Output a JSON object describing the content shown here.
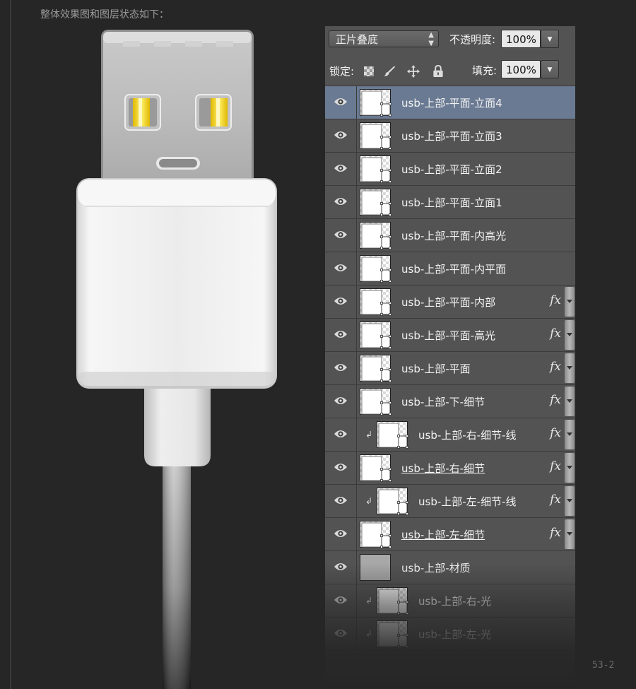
{
  "caption": "整体效果图和图层状态如下：",
  "page_number": "53-2",
  "panel": {
    "blend_mode": "正片叠底",
    "opacity_label": "不透明度:",
    "opacity_value": "100%",
    "lock_label": "锁定:",
    "fill_label": "填充:",
    "fill_value": "100%"
  },
  "layers": [
    {
      "name": "usb-上部-平面-立面4",
      "selected": true,
      "fx": false,
      "clipped": false,
      "linked": false
    },
    {
      "name": "usb-上部-平面-立面3",
      "selected": false,
      "fx": false,
      "clipped": false,
      "linked": false
    },
    {
      "name": "usb-上部-平面-立面2",
      "selected": false,
      "fx": false,
      "clipped": false,
      "linked": false
    },
    {
      "name": "usb-上部-平面-立面1",
      "selected": false,
      "fx": false,
      "clipped": false,
      "linked": false
    },
    {
      "name": "usb-上部-平面-内高光",
      "selected": false,
      "fx": false,
      "clipped": false,
      "linked": false
    },
    {
      "name": "usb-上部-平面-内平面",
      "selected": false,
      "fx": false,
      "clipped": false,
      "linked": false
    },
    {
      "name": "usb-上部-平面-内部",
      "selected": false,
      "fx": true,
      "clipped": false,
      "linked": false
    },
    {
      "name": "usb-上部-平面-高光",
      "selected": false,
      "fx": true,
      "clipped": false,
      "linked": false
    },
    {
      "name": "usb-上部-平面",
      "selected": false,
      "fx": true,
      "clipped": false,
      "linked": false
    },
    {
      "name": "usb-上部-下-细节",
      "selected": false,
      "fx": true,
      "clipped": false,
      "linked": false
    },
    {
      "name": "usb-上部-右-细节-线",
      "selected": false,
      "fx": true,
      "clipped": true,
      "linked": false
    },
    {
      "name": "usb-上部-右-细节",
      "selected": false,
      "fx": true,
      "clipped": false,
      "linked": true
    },
    {
      "name": "usb-上部-左-细节-线",
      "selected": false,
      "fx": true,
      "clipped": true,
      "linked": false
    },
    {
      "name": "usb-上部-左-细节",
      "selected": false,
      "fx": true,
      "clipped": false,
      "linked": true
    },
    {
      "name": "usb-上部-材质",
      "selected": false,
      "fx": false,
      "clipped": false,
      "linked": false,
      "texture": true
    },
    {
      "name": "usb-上部-右-光",
      "selected": false,
      "fx": false,
      "clipped": true,
      "linked": false
    },
    {
      "name": "usb-上部-左-光",
      "selected": false,
      "fx": false,
      "clipped": true,
      "linked": false
    }
  ],
  "icons": {
    "visibility": "eye-icon",
    "clip": "clipping-arrow-icon",
    "effects": "fx-icon",
    "lock_transparent": "checkerboard-lock-icon",
    "lock_paint": "brush-lock-icon",
    "lock_move": "move-lock-icon",
    "lock_all": "padlock-icon"
  }
}
